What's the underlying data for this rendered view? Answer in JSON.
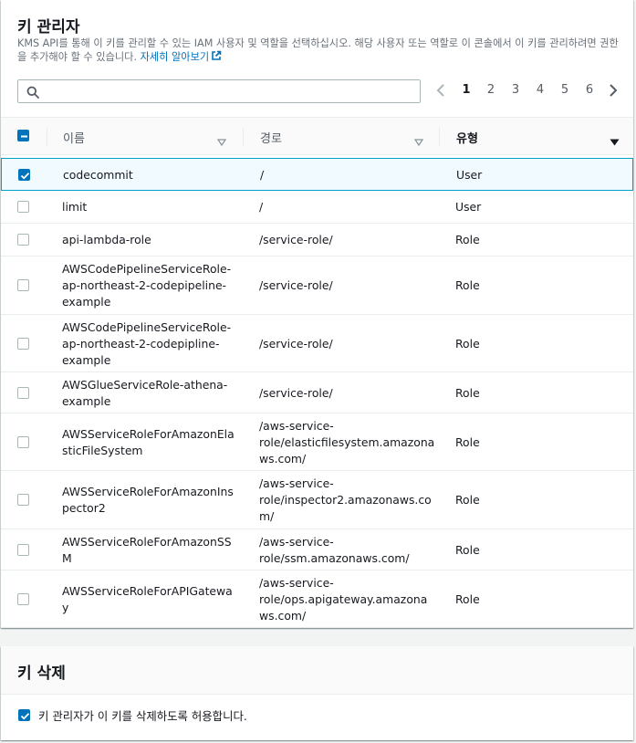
{
  "admins": {
    "title": "키 관리자",
    "description": "KMS API를 통해 이 키를 관리할 수 있는 IAM 사용자 및 역할을 선택하십시오. 해당 사용자 또는 역할로 이 콘솔에서 이 키를 관리하려면 권한을 추가해야 할 수 있습니다.",
    "learn_more": "자세히 알아보기",
    "search": {
      "value": "",
      "placeholder": ""
    },
    "pagination": {
      "pages": [
        "1",
        "2",
        "3",
        "4",
        "5",
        "6"
      ],
      "current": "1"
    },
    "columns": {
      "name": "이름",
      "path": "경로",
      "type": "유형"
    },
    "rows": [
      {
        "name": [
          "codecommit"
        ],
        "path": [
          "/"
        ],
        "type": "User",
        "checked": true
      },
      {
        "name": [
          "limit"
        ],
        "path": [
          "/"
        ],
        "type": "User",
        "checked": false
      },
      {
        "name": [
          "api-lambda-role"
        ],
        "path": [
          "/service-role/"
        ],
        "type": "Role",
        "checked": false
      },
      {
        "name": [
          "AWSCodePipelineServiceRole-",
          "ap-northeast-2-codepipeline-",
          "example"
        ],
        "path": [
          "/service-role/"
        ],
        "type": "Role",
        "checked": false
      },
      {
        "name": [
          "AWSCodePipelineServiceRole-",
          "ap-northeast-2-codepipline-",
          "example"
        ],
        "path": [
          "/service-role/"
        ],
        "type": "Role",
        "checked": false
      },
      {
        "name": [
          "AWSGlueServiceRole-athena-",
          "example"
        ],
        "path": [
          "/service-role/"
        ],
        "type": "Role",
        "checked": false
      },
      {
        "name": [
          "AWSServiceRoleForAmazonEla",
          "sticFileSystem"
        ],
        "path": [
          "/aws-service-",
          "role/elasticfilesystem.amazona",
          "ws.com/"
        ],
        "type": "Role",
        "checked": false
      },
      {
        "name": [
          "AWSServiceRoleForAmazonIns",
          "pector2"
        ],
        "path": [
          "/aws-service-",
          "role/inspector2.amazonaws.co",
          "m/"
        ],
        "type": "Role",
        "checked": false
      },
      {
        "name": [
          "AWSServiceRoleForAmazonSS",
          "M"
        ],
        "path": [
          "/aws-service-",
          "role/ssm.amazonaws.com/"
        ],
        "type": "Role",
        "checked": false
      },
      {
        "name": [
          "AWSServiceRoleForAPIGatewa",
          "y"
        ],
        "path": [
          "/aws-service-",
          "role/ops.apigateway.amazona",
          "ws.com/"
        ],
        "type": "Role",
        "checked": false
      }
    ]
  },
  "deletion": {
    "title": "키 삭제",
    "allow_label": "키 관리자가 이 키를 삭제하도록 허용합니다.",
    "allow_checked": true
  },
  "colors": {
    "accent": "#0073bb",
    "selected_border": "#00a1c9",
    "selected_bg": "#f1faff"
  }
}
